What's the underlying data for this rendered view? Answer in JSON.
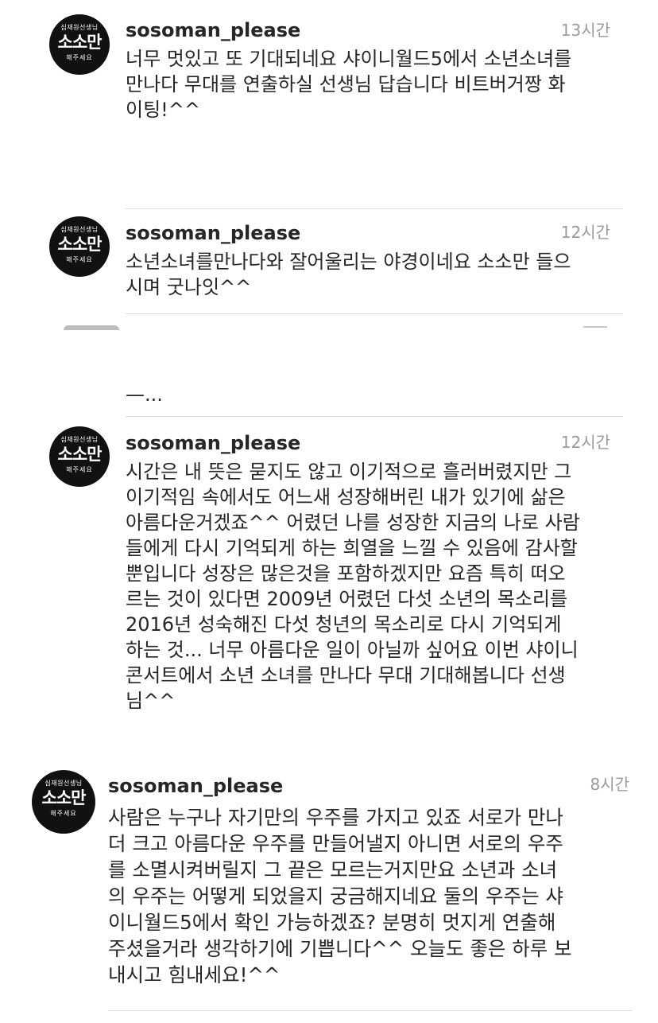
{
  "avatar": {
    "top_text": "심재원선생님",
    "mid_text": "소소만",
    "bot_text": "해주세요"
  },
  "comments": [
    {
      "username": "sosoman_please",
      "time": "13시간",
      "text": "너무 멋있고 또 기대되네요 샤이니월드5에서 소년소녀를\n만나다 무대를 연출하실 선생님 답습니다 비트버거짱 화\n이팅!^^"
    },
    {
      "username": "sosoman_please",
      "time": "12시간",
      "text": "소년소녀를만나다와 잘어울리는 야경이네요 소소만 들으\n시며 굿나잇^^"
    },
    {
      "username": "",
      "time": "",
      "text": "—..."
    },
    {
      "username": "sosoman_please",
      "time": "12시간",
      "text": "시간은 내 뜻은 묻지도 않고 이기적으로 흘러버렸지만 그\n이기적임 속에서도 어느새 성장해버린 내가 있기에 삶은\n아름다운거겠죠^^ 어렸던 나를  성장한 지금의 나로 사람\n들에게 다시 기억되게 하는 희열을 느낄 수 있음에 감사할\n뿐입니다 성장은 많은것을 포함하겠지만 요즘 특히 떠오\n르는 것이 있다면 2009년 어렸던 다섯 소년의 목소리를\n2016년 성숙해진 다섯 청년의 목소리로 다시 기억되게\n하는 것... 너무 아름다운 일이 아닐까 싶어요 이번 샤이니\n콘서트에서 소년 소녀를 만나다 무대 기대해봅니다 선생\n님^^"
    },
    {
      "username": "sosoman_please",
      "time": "8시간",
      "text": "사람은 누구나 자기만의 우주를 가지고 있죠 서로가 만나\n더 크고 아름다운 우주를 만들어낼지 아니면 서로의 우주\n를 소멸시켜버릴지 그 끝은 모르는거지만요 소년과 소녀\n의 우주는 어떻게 되었을지 궁금해지네요 둘의 우주는 샤\n이니월드5에서 확인 가능하겠죠? 분명히 멋지게 연출해\n주셨을거라 생각하기에 기쁩니다^^ 오늘도 좋은 하루 보\n내시고 힘내세요!^^"
    }
  ]
}
